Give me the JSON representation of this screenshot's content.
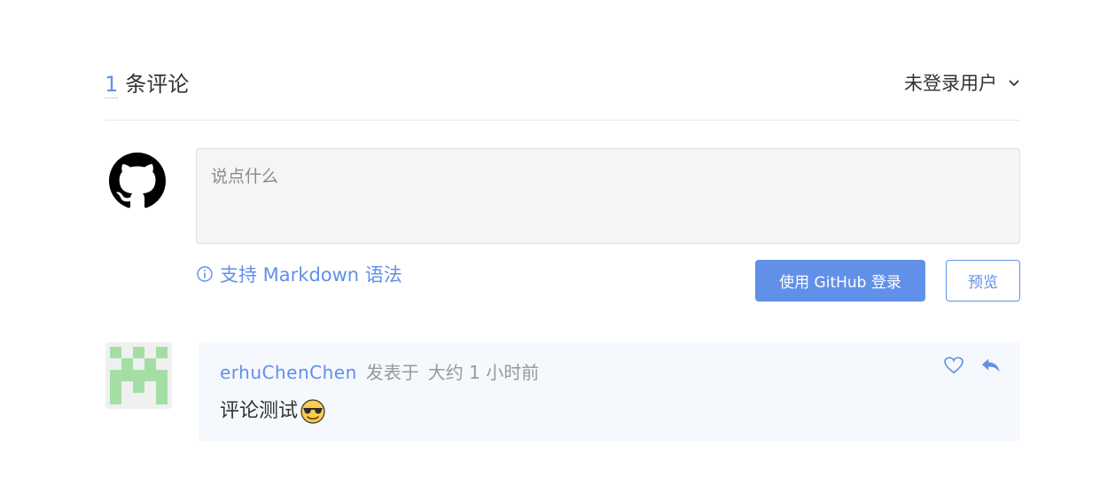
{
  "header": {
    "comment_count": "1",
    "comment_count_suffix": "条评论",
    "user_menu_label": "未登录用户"
  },
  "editor": {
    "placeholder": "说点什么",
    "markdown_tip": "支持 Markdown 语法",
    "login_button": "使用 GitHub 登录",
    "preview_button": "预览"
  },
  "comments": [
    {
      "author": "erhuChenChen",
      "posted_label": "发表于",
      "time": "大约 1 小时前",
      "body": "评论测试",
      "emoji": "sunglasses-emoji"
    }
  ],
  "colors": {
    "accent": "#6190e8",
    "identicon": "#a3dfa4",
    "card_bg": "#f5f8fc"
  }
}
